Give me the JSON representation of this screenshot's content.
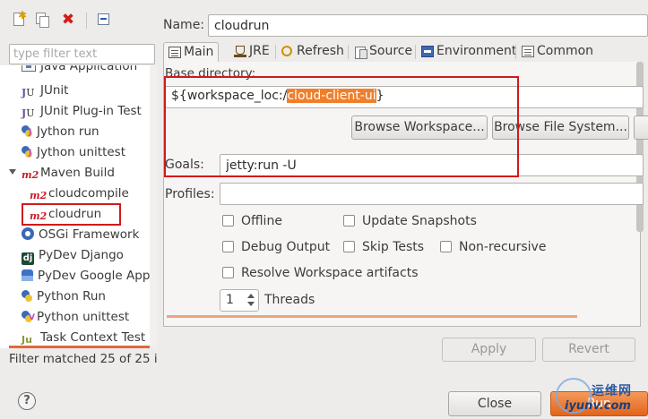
{
  "left": {
    "filter_placeholder": "type filter text",
    "tree_items": [
      {
        "label": "Java Application",
        "icon": "java-app-icon"
      },
      {
        "label": "JUnit",
        "icon": "junit-icon"
      },
      {
        "label": "JUnit Plug-in Test",
        "icon": "junit-plugin-icon"
      },
      {
        "label": "Jython run",
        "icon": "jython-run-icon"
      },
      {
        "label": "Jython unittest",
        "icon": "jython-unittest-icon"
      },
      {
        "label": "Maven Build",
        "icon": "maven-icon",
        "expanded": true
      },
      {
        "label": "cloudcompile",
        "icon": "maven-icon"
      },
      {
        "label": "cloudrun",
        "icon": "maven-icon",
        "selected": true
      },
      {
        "label": "OSGi Framework",
        "icon": "osgi-icon"
      },
      {
        "label": "PyDev Django",
        "icon": "django-icon"
      },
      {
        "label": "PyDev Google App E",
        "icon": "google-app-engine-icon"
      },
      {
        "label": "Python Run",
        "icon": "python-run-icon"
      },
      {
        "label": "Python unittest",
        "icon": "python-unittest-icon"
      },
      {
        "label": "Task Context Test",
        "icon": "task-context-icon"
      }
    ],
    "filter_status": "Filter matched 25 of 25 i"
  },
  "right": {
    "name_label": "Name:",
    "name_value": "cloudrun",
    "tabs": [
      {
        "label": "Main",
        "active": true
      },
      {
        "label": "JRE"
      },
      {
        "label": "Refresh"
      },
      {
        "label": "Source"
      },
      {
        "label": "Environment"
      },
      {
        "label": "Common"
      }
    ],
    "base_directory_label": "Base directory:",
    "base_directory_prefix": "${workspace_loc:/",
    "base_directory_highlight": "cloud-client-ui",
    "base_directory_suffix": "}",
    "browse_workspace": "Browse Workspace...",
    "browse_file_system": "Browse File System...",
    "goals_label": "Goals:",
    "goals_value": "jetty:run -U",
    "profiles_label": "Profiles:",
    "profiles_value": "",
    "checkboxes": [
      {
        "label": "Offline",
        "checked": false
      },
      {
        "label": "Update Snapshots",
        "checked": false
      },
      {
        "label": "Debug Output",
        "checked": false
      },
      {
        "label": "Skip Tests",
        "checked": false
      },
      {
        "label": "Non-recursive",
        "checked": false
      },
      {
        "label": "Resolve Workspace artifacts",
        "checked": false
      }
    ],
    "threads_value": "1",
    "threads_label": "Threads",
    "apply": "Apply",
    "revert": "Revert",
    "close": "Close",
    "run": "Run"
  },
  "watermark": {
    "line1": "运维网",
    "line2": "iyunv.com"
  },
  "colors": {
    "highlight": "#f07f2c",
    "annotation_red": "#d01a1a",
    "run_button": "#e2641a"
  }
}
